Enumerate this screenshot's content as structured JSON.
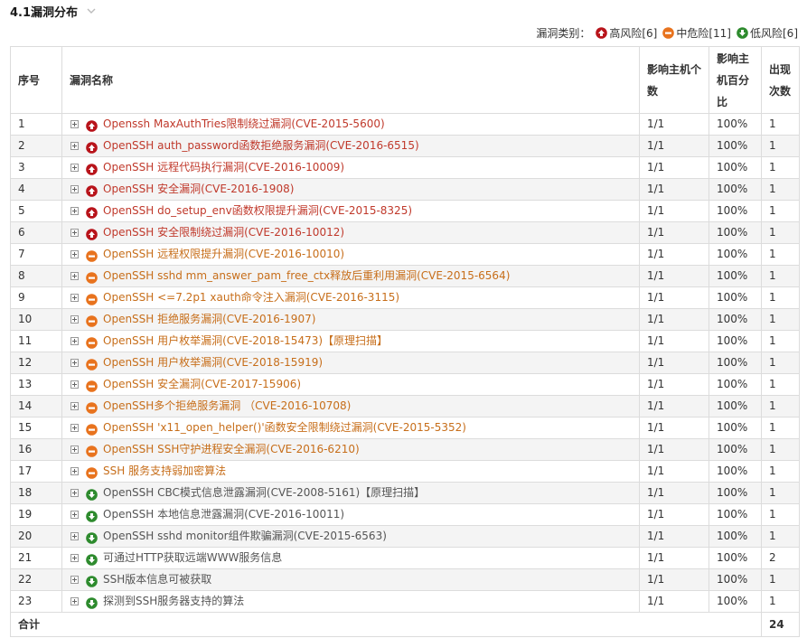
{
  "section": {
    "title": "4.1漏洞分布"
  },
  "legend": {
    "label": "漏洞类别：",
    "high": "高风险[6]",
    "mid": "中危险[11]",
    "low": "低风险[6]"
  },
  "colors": {
    "high": "#b8141b",
    "mid": "#e8731e",
    "low": "#2e8b2e"
  },
  "table": {
    "headers": {
      "index": "序号",
      "name": "漏洞名称",
      "hosts": "影响主机个数",
      "percent": "影响主机百分比",
      "count": "出现次数"
    },
    "rows": [
      {
        "index": "1",
        "level": "high",
        "name": "Openssh MaxAuthTries限制绕过漏洞(CVE-2015-5600)",
        "hosts": "1/1",
        "percent": "100%",
        "count": "1"
      },
      {
        "index": "2",
        "level": "high",
        "name": "OpenSSH auth_password函数拒绝服务漏洞(CVE-2016-6515)",
        "hosts": "1/1",
        "percent": "100%",
        "count": "1"
      },
      {
        "index": "3",
        "level": "high",
        "name": "OpenSSH 远程代码执行漏洞(CVE-2016-10009)",
        "hosts": "1/1",
        "percent": "100%",
        "count": "1"
      },
      {
        "index": "4",
        "level": "high",
        "name": "OpenSSH 安全漏洞(CVE-2016-1908)",
        "hosts": "1/1",
        "percent": "100%",
        "count": "1"
      },
      {
        "index": "5",
        "level": "high",
        "name": "OpenSSH do_setup_env函数权限提升漏洞(CVE-2015-8325)",
        "hosts": "1/1",
        "percent": "100%",
        "count": "1"
      },
      {
        "index": "6",
        "level": "high",
        "name": "OpenSSH 安全限制绕过漏洞(CVE-2016-10012)",
        "hosts": "1/1",
        "percent": "100%",
        "count": "1"
      },
      {
        "index": "7",
        "level": "mid",
        "name": "OpenSSH 远程权限提升漏洞(CVE-2016-10010)",
        "hosts": "1/1",
        "percent": "100%",
        "count": "1"
      },
      {
        "index": "8",
        "level": "mid",
        "name": "OpenSSH sshd mm_answer_pam_free_ctx释放后重利用漏洞(CVE-2015-6564)",
        "hosts": "1/1",
        "percent": "100%",
        "count": "1"
      },
      {
        "index": "9",
        "level": "mid",
        "name": "OpenSSH <=7.2p1 xauth命令注入漏洞(CVE-2016-3115)",
        "hosts": "1/1",
        "percent": "100%",
        "count": "1"
      },
      {
        "index": "10",
        "level": "mid",
        "name": "OpenSSH 拒绝服务漏洞(CVE-2016-1907)",
        "hosts": "1/1",
        "percent": "100%",
        "count": "1"
      },
      {
        "index": "11",
        "level": "mid",
        "name": "OpenSSH 用户枚举漏洞(CVE-2018-15473)【原理扫描】",
        "hosts": "1/1",
        "percent": "100%",
        "count": "1"
      },
      {
        "index": "12",
        "level": "mid",
        "name": "OpenSSH 用户枚举漏洞(CVE-2018-15919)",
        "hosts": "1/1",
        "percent": "100%",
        "count": "1"
      },
      {
        "index": "13",
        "level": "mid",
        "name": "OpenSSH 安全漏洞(CVE-2017-15906)",
        "hosts": "1/1",
        "percent": "100%",
        "count": "1"
      },
      {
        "index": "14",
        "level": "mid",
        "name": "OpenSSH多个拒绝服务漏洞 （CVE-2016-10708)",
        "hosts": "1/1",
        "percent": "100%",
        "count": "1"
      },
      {
        "index": "15",
        "level": "mid",
        "name": "OpenSSH 'x11_open_helper()'函数安全限制绕过漏洞(CVE-2015-5352)",
        "hosts": "1/1",
        "percent": "100%",
        "count": "1"
      },
      {
        "index": "16",
        "level": "mid",
        "name": "OpenSSH SSH守护进程安全漏洞(CVE-2016-6210)",
        "hosts": "1/1",
        "percent": "100%",
        "count": "1"
      },
      {
        "index": "17",
        "level": "mid",
        "name": "SSH 服务支持弱加密算法",
        "hosts": "1/1",
        "percent": "100%",
        "count": "1"
      },
      {
        "index": "18",
        "level": "low",
        "name": "OpenSSH CBC模式信息泄露漏洞(CVE-2008-5161)【原理扫描】",
        "hosts": "1/1",
        "percent": "100%",
        "count": "1"
      },
      {
        "index": "19",
        "level": "low",
        "name": "OpenSSH 本地信息泄露漏洞(CVE-2016-10011)",
        "hosts": "1/1",
        "percent": "100%",
        "count": "1"
      },
      {
        "index": "20",
        "level": "low",
        "name": "OpenSSH sshd monitor组件欺骗漏洞(CVE-2015-6563)",
        "hosts": "1/1",
        "percent": "100%",
        "count": "1"
      },
      {
        "index": "21",
        "level": "low",
        "name": "可通过HTTP获取远端WWW服务信息",
        "hosts": "1/1",
        "percent": "100%",
        "count": "2"
      },
      {
        "index": "22",
        "level": "low",
        "name": "SSH版本信息可被获取",
        "hosts": "1/1",
        "percent": "100%",
        "count": "1"
      },
      {
        "index": "23",
        "level": "low",
        "name": "探测到SSH服务器支持的算法",
        "hosts": "1/1",
        "percent": "100%",
        "count": "1"
      }
    ],
    "total": {
      "label": "合计",
      "count": "24"
    }
  }
}
